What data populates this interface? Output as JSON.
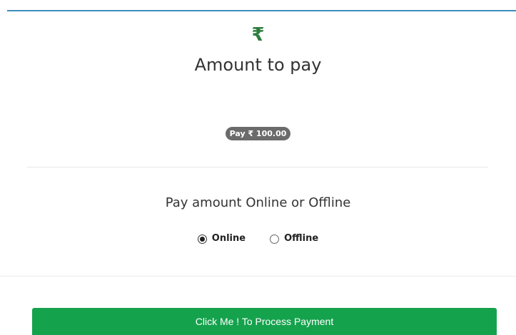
{
  "header": {
    "currency_symbol": "₹",
    "title": "Amount to pay"
  },
  "amount_badge": {
    "label": "Pay ₹ 100.00"
  },
  "payment_mode": {
    "heading": "Pay amount Online or Offline",
    "options": [
      {
        "label": "Online",
        "selected": true
      },
      {
        "label": "Offline",
        "selected": false
      }
    ]
  },
  "actions": {
    "process_payment_label": "Click Me ! To Process Payment"
  },
  "colors": {
    "accent_rule": "#3c8dbc",
    "currency_icon": "#2e7d3e",
    "badge_background": "#6b6b6b",
    "button_background": "#15a24d"
  }
}
